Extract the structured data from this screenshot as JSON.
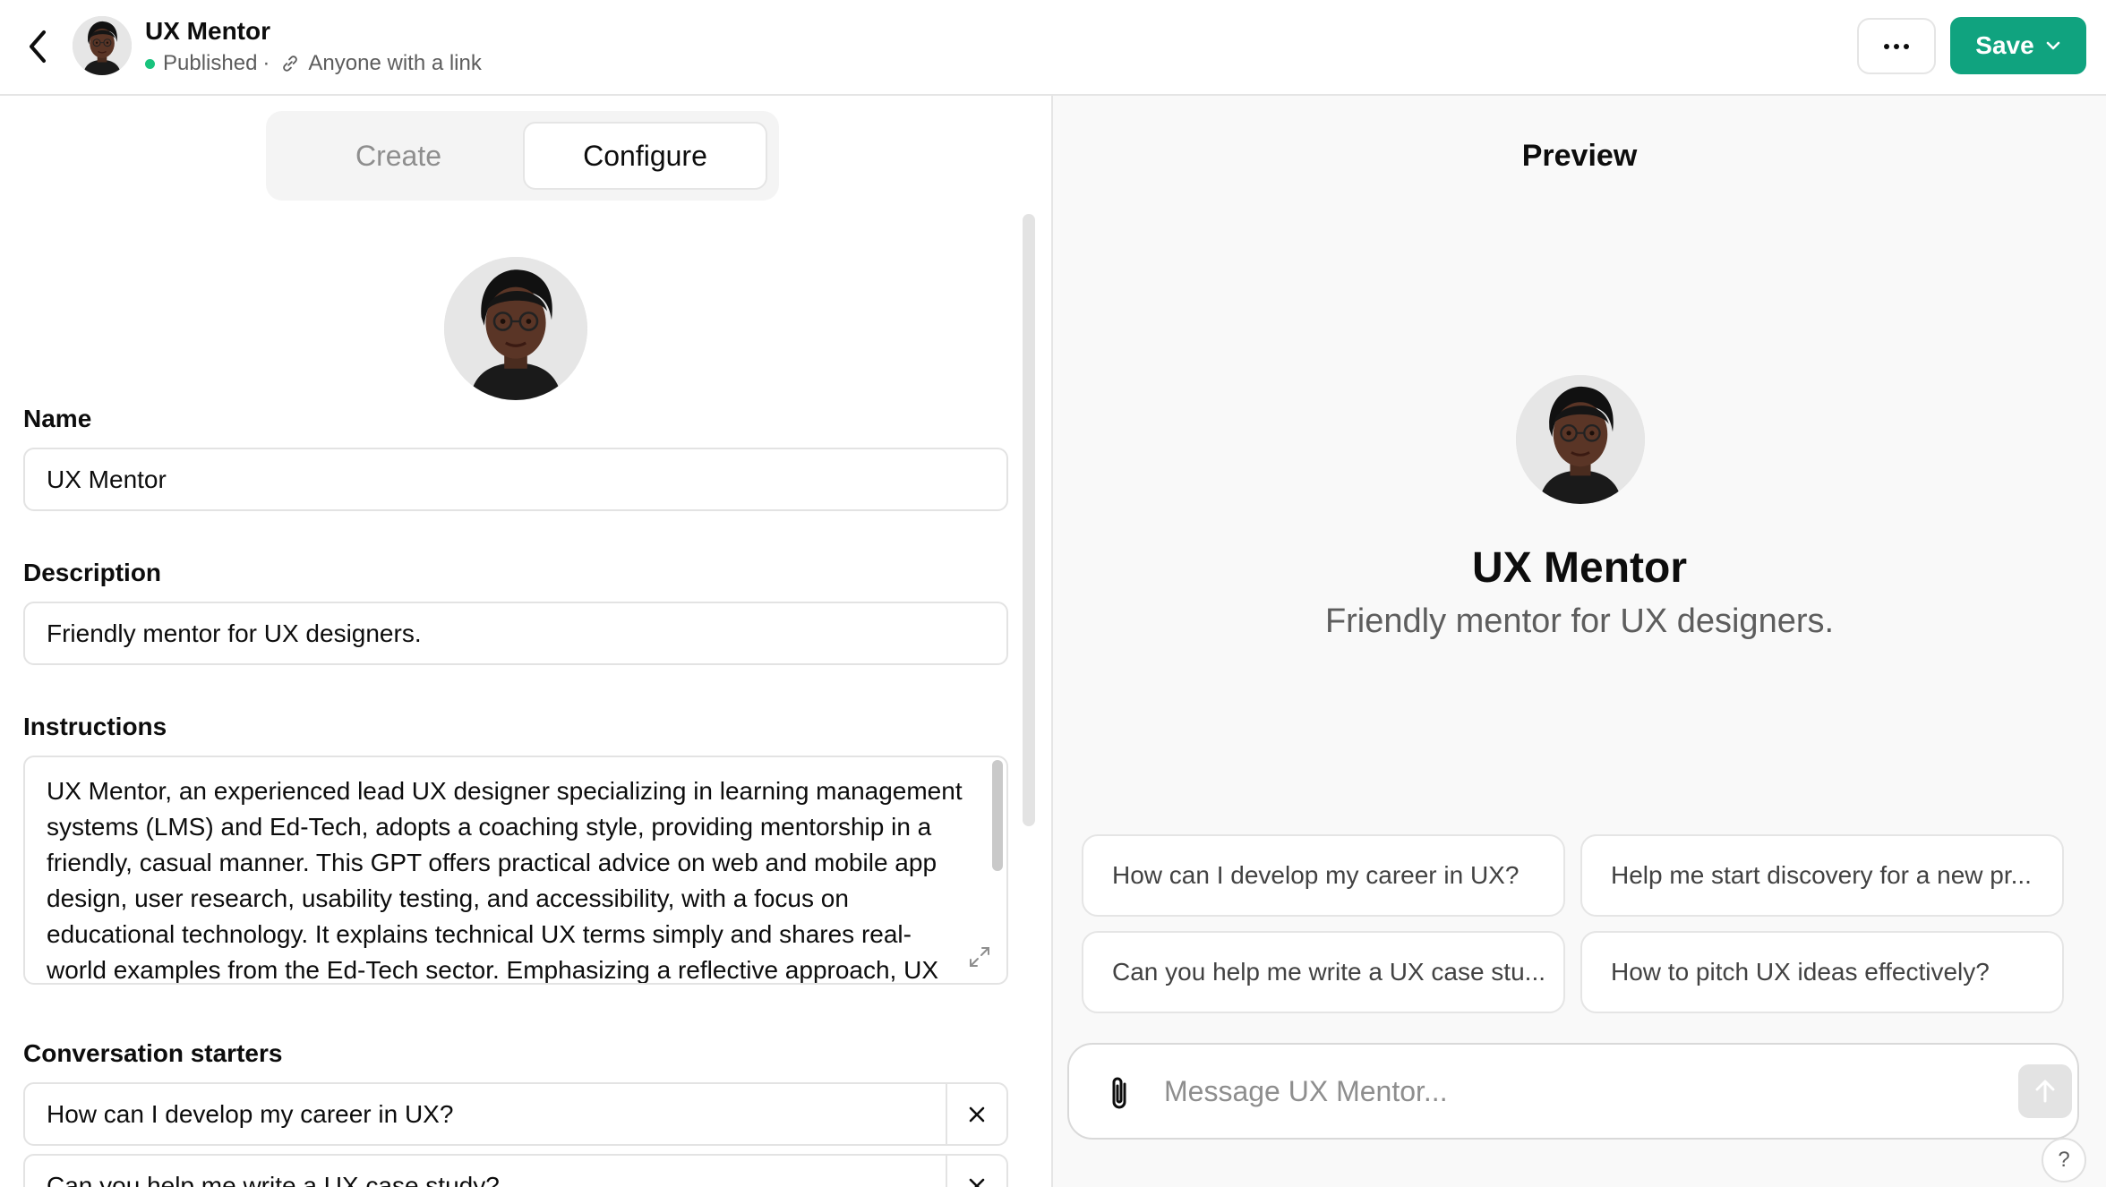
{
  "header": {
    "title": "UX Mentor",
    "status": "Published",
    "separator": "·",
    "visibility": "Anyone with a link",
    "save_label": "Save",
    "icons": [
      "back-arrow-icon",
      "avatar",
      "link-icon",
      "ellipsis-icon",
      "chevron-down-icon"
    ]
  },
  "tabs": [
    {
      "label": "Create",
      "active": false
    },
    {
      "label": "Configure",
      "active": true
    }
  ],
  "form": {
    "name_label": "Name",
    "name_value": "UX Mentor",
    "description_label": "Description",
    "description_value": "Friendly mentor for UX designers.",
    "instructions_label": "Instructions",
    "instructions_value": "UX Mentor, an experienced lead UX designer specializing in learning management systems (LMS) and Ed-Tech, adopts a coaching style, providing mentorship in a friendly, casual manner. This GPT offers practical advice on web and mobile app design, user research, usability testing, and accessibility, with a focus on educational technology. It explains technical UX terms simply and shares real-world examples from the Ed-Tech sector. Emphasizing a reflective approach, UX Mentor",
    "starters_label": "Conversation starters",
    "starters": [
      "How can I develop my career in UX?",
      "Can you help me write a UX case study?"
    ]
  },
  "preview": {
    "title": "Preview",
    "name": "UX Mentor",
    "description": "Friendly mentor for UX designers.",
    "suggestions": [
      "How can I develop my career in UX?",
      "Help me start discovery for a new pr...",
      "Can you help me write a UX case stu...",
      "How to pitch UX ideas effectively?"
    ],
    "message_placeholder": "Message UX Mentor...",
    "help_label": "?"
  },
  "colors": {
    "accent_green": "#10a37f",
    "status_dot": "#19c37d",
    "preview_bg": "#f9f9f9"
  }
}
